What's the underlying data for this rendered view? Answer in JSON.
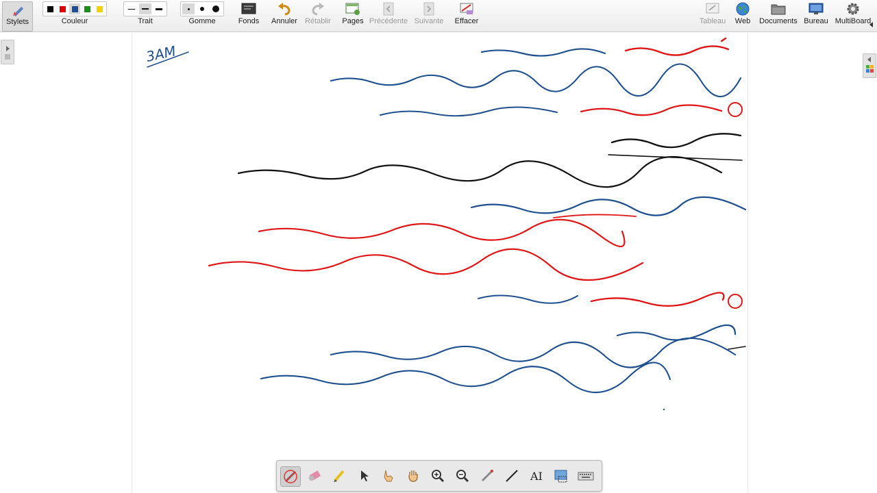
{
  "toolbar": {
    "stylets": "Stylets",
    "couleur": "Couleur",
    "trait": "Trait",
    "gomme": "Gomme",
    "fonds": "Fonds",
    "annuler": "Annuler",
    "retablir": "Rétablir",
    "pages": "Pages",
    "precedente": "Précédente",
    "suivante": "Suivante",
    "effacer": "Effacer",
    "tableau": "Tableau",
    "web": "Web",
    "documents": "Documents",
    "bureau": "Bureau",
    "multiboard": "MultiBoard"
  },
  "colors": {
    "palette": [
      "#000000",
      "#e00000",
      "#1f4e96",
      "#1a8f1a",
      "#f2d400"
    ],
    "ink_blue": "#1e4f8f",
    "ink_red": "#e01515",
    "ink_black": "#111111"
  },
  "notes": {
    "corner": "3AM",
    "lines": [
      {
        "text": "فعل الأمر: يدل على الطلب",
        "color": "mixed"
      },
      {
        "text": "دوماً مبني ← يبنى على ما يجزم به مضارعه",
        "color": "blue"
      },
      {
        "text": "① يبنى على السكون: صحيح الآخر + نون النسوة",
        "color": "mixed"
      },
      {
        "text": "اكتبْ درسكَ",
        "color": "black"
      },
      {
        "text": "← فعل أمر مبني على السكون والفاعل ضمير مستتر تقديره أنت",
        "color": "black"
      },
      {
        "text": "يا طالبات اكتبْنَ الواجب",
        "color": "blue"
      },
      {
        "text": "← فعل أمر مبني على السكون لاتصاله بنون النسوة",
        "color": "red"
      },
      {
        "text": "ونون النسوة ضمير متصل مبني على الفتح في محل رفع فاعل",
        "color": "red"
      },
      {
        "text": "② يبنى على الفتح: نون التوكيد",
        "color": "mixed"
      },
      {
        "text": "اتّبعَنَّ الحق",
        "color": "blue"
      },
      {
        "text": "← فعل أمر مبني على الفتح لاتصاله بنون التوكيد",
        "color": "blue"
      },
      {
        "text": "نون التوكيد حرف مبني على الفتح لا محل له من الإعراب",
        "color": "blue"
      }
    ]
  },
  "dock_tools": [
    "pen-tool",
    "eraser-tool",
    "highlighter-tool",
    "pointer-tool",
    "hand-pointer-tool",
    "pan-tool",
    "zoom-in-tool",
    "zoom-out-tool",
    "laser-pen-tool",
    "line-tool",
    "text-tool",
    "screen-capture-tool",
    "keyboard-tool"
  ]
}
